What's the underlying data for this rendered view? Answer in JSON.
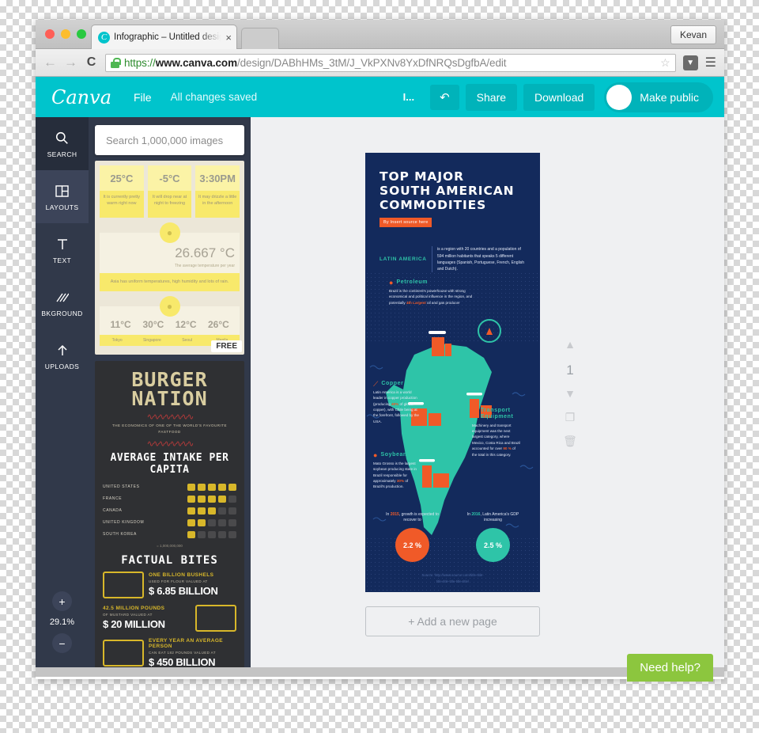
{
  "browser": {
    "tab": {
      "title": "Infographic – Untitled desig",
      "favicon_letter": "C",
      "close": "×"
    },
    "account_button": "Kevan",
    "nav": {
      "back": "←",
      "forward": "→",
      "reload": "C"
    },
    "url": {
      "scheme": "https://",
      "host": "www.canva.com",
      "path": "/design/DABhHMs_3tM/J_VkPXNv8YxDfNRQsDgfbA/edit"
    },
    "star": "☆",
    "menu": "☰"
  },
  "appbar": {
    "logo": "Canva",
    "file_label": "File",
    "saved_label": "All changes saved",
    "small_icon_label": "I...",
    "undo_label": "↶",
    "share_label": "Share",
    "download_label": "Download",
    "make_public_label": "Make public"
  },
  "rail": {
    "items": [
      {
        "label": "SEARCH",
        "icon": "🔍",
        "state": "active"
      },
      {
        "label": "LAYOUTS",
        "icon": "▥",
        "state": "highlight"
      },
      {
        "label": "TEXT",
        "icon": "T",
        "state": "normal"
      },
      {
        "label": "BKGROUND",
        "icon": "▓",
        "state": "normal"
      },
      {
        "label": "UPLOADS",
        "icon": "↑",
        "state": "normal"
      }
    ],
    "zoom": {
      "in": "+",
      "out": "−",
      "value": "29.1%"
    }
  },
  "panel": {
    "search_placeholder": "Search 1,000,000 images",
    "weather_thumb": {
      "free_badge": "FREE",
      "cards": [
        {
          "value": "25°C",
          "note": "It is currently pretty warm right now"
        },
        {
          "value": "-5°C",
          "note": "It will drop near at night to freezing"
        },
        {
          "value": "3:30PM",
          "note": "It may drizzle a little in the afternoon"
        }
      ],
      "big_value": "26.667 °C",
      "big_caption": "The average temperature per year",
      "bar_text": "Asia has uniform temperatures, high humidity and lots of rain.",
      "temps": [
        "11°C",
        "30°C",
        "12°C",
        "26°C"
      ],
      "cities": [
        "Tokyo",
        "Singapore",
        "Seoul",
        "Manila"
      ]
    },
    "burger_thumb": {
      "title_line1": "BURGER",
      "title_line2": "NATION",
      "subtitle": "THE ECONOMICS OF ONE OF THE WORLD'S FAVOURITE FASTFOOD",
      "section1": "AVERAGE INTAKE PER CAPITA",
      "rows": [
        {
          "country": "UNITED STATES",
          "filled": 5
        },
        {
          "country": "FRANCE",
          "filled": 4
        },
        {
          "country": "CANADA",
          "filled": 3
        },
        {
          "country": "UNITED KINGDOM",
          "filled": 2
        },
        {
          "country": "SOUTH KOREA",
          "filled": 1
        }
      ],
      "legend": "= 1,000,000,000",
      "section2": "FACTUAL BITES",
      "facts": [
        {
          "t1": "ONE BILLION BUSHELS",
          "t2": "USED FOR FLOUR VALUED AT",
          "t3": "$ 6.85 BILLION"
        },
        {
          "t1": "42.5 MILLION POUNDS",
          "t2": "OF MUSTARD VALUED AT",
          "t3": "$ 20 MILLION"
        },
        {
          "t1": "EVERY YEAR AN AVERAGE PERSON",
          "t2": "CAN EAT 182 POUNDS VALUED AT",
          "t3": "$ 450 BILLION"
        }
      ]
    }
  },
  "infographic": {
    "title": "TOP MAJOR\nSOUTH AMERICAN\nCOMMODITIES",
    "title_lines": [
      "TOP MAJOR",
      "SOUTH AMERICAN",
      "COMMODITIES"
    ],
    "source_badge": "By Insert source here",
    "region_label": "LATIN AMERICA",
    "region_text": "is a region with 20 countries and a population of 594 million habitants that speaks 5 different languages (Spanish, Portuguese, French, English and Dutch).",
    "sections": [
      {
        "icon": "💧",
        "title": "Petroleum",
        "body_pre": "Brazil is the continent's powerhouse with strong economical and political influence in the region, and potentially ",
        "highlight": "4th Largest",
        "body_post": " oil and gas producer"
      },
      {
        "icon": "⛏",
        "title": "Copper",
        "body_pre": "Latin America is a world leader in copper production (producing ",
        "highlight": "48%",
        "body_post": " of global copper), with Chile being at the forefront, followed by the USA."
      },
      {
        "icon": "🚗",
        "title": "Transport Equipment",
        "body_pre": "Machinery and transport equipment was the next largest category, where Mexico, Costa Rica and Brazil accounted for over ",
        "highlight": "90 %",
        "body_post": " of the total in this category."
      },
      {
        "icon": "●",
        "title": "Soybeans",
        "body_pre": "Mato Grosso is the largest soybean producing state in Brazil responsible for approximately ",
        "highlight": "30%",
        "body_post": " of Brazil's production."
      }
    ],
    "stats": [
      {
        "caption_pre": "In ",
        "year": "2015",
        "caption_post": ", growth is expected to recover to",
        "value": "2.2 %",
        "color": "#f05a28"
      },
      {
        "caption_pre": "In ",
        "year": "2016",
        "caption_post": ", Latin America's GDP increasing",
        "value": "2.5 %",
        "color": "#2ec4a8"
      }
    ],
    "source_line1": "Source: http://www.source.com/title-title-",
    "source_line2": "title-title-title-title-title/"
  },
  "canvas": {
    "add_page_label": "+ Add a new page",
    "page_number": "1",
    "move_up_icon": "▲",
    "move_down_icon": "▼",
    "duplicate_icon": "❐",
    "delete_icon": "🗑",
    "need_help_label": "Need help?"
  }
}
